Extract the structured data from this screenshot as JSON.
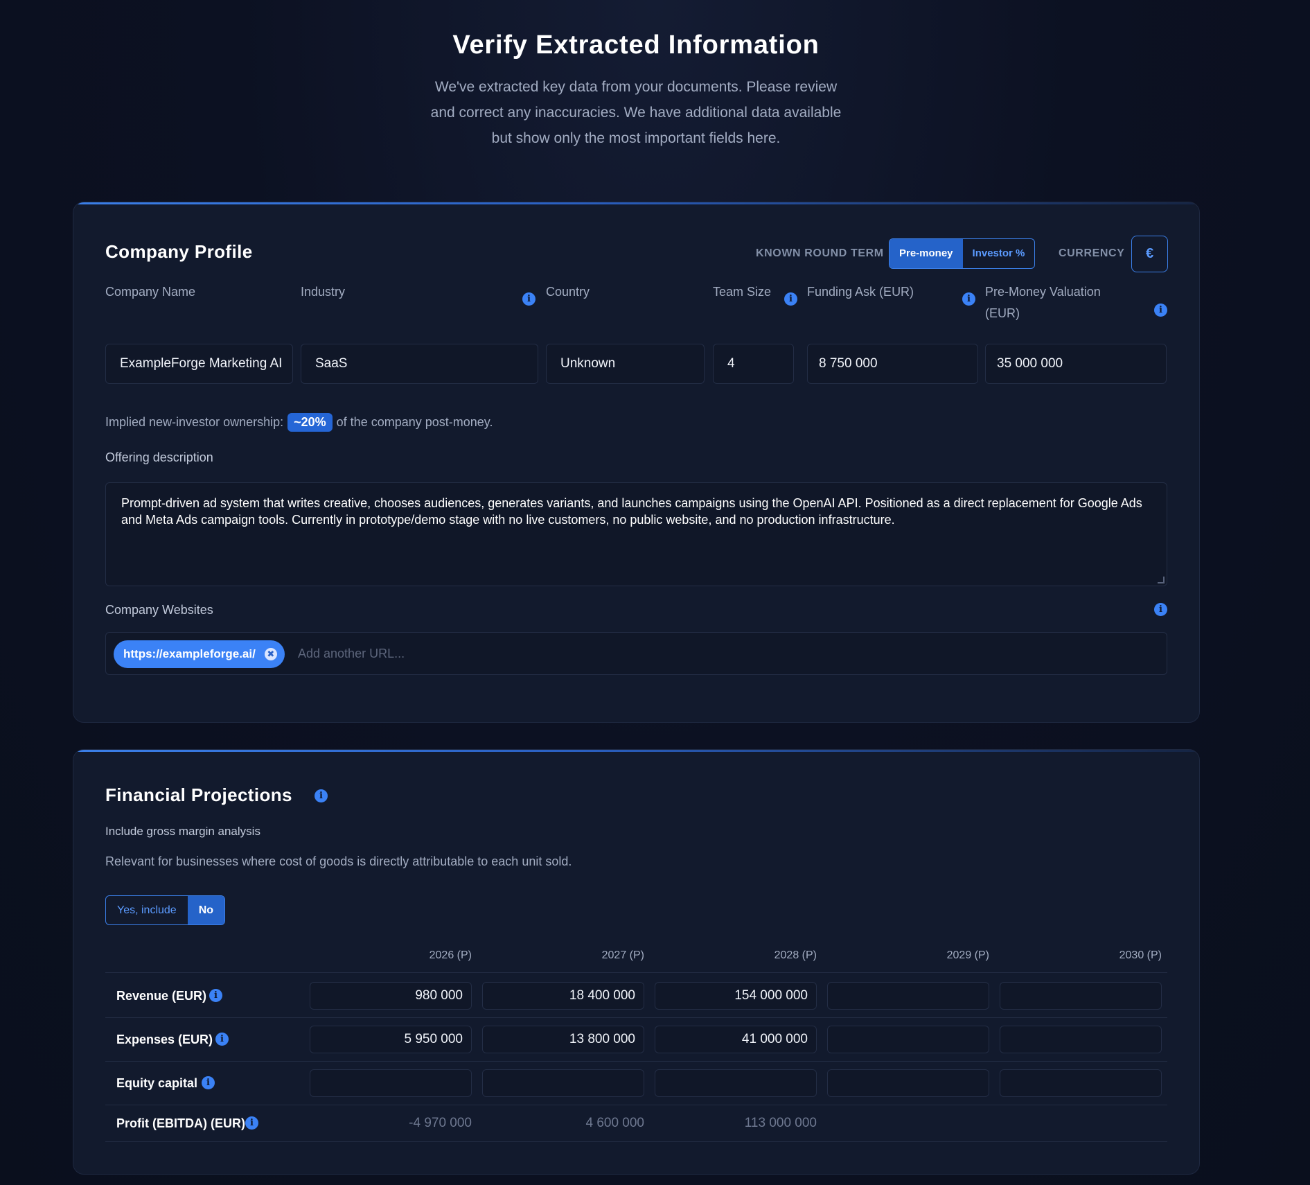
{
  "header": {
    "title": "Verify Extracted Information",
    "subtitle": "We've extracted key data from your documents. Please review and correct any inaccuracies. We have additional data available but show only the most important fields here."
  },
  "profile": {
    "title": "Company Profile",
    "round_term_label": "KNOWN ROUND TERM",
    "round_term_options": [
      "Pre-money",
      "Investor %"
    ],
    "round_term_selected": "Pre-money",
    "currency_label": "CURRENCY",
    "currency_symbol": "€",
    "fields": {
      "company_name": {
        "label": "Company Name",
        "value": "ExampleForge Marketing AI"
      },
      "industry": {
        "label": "Industry",
        "value": "SaaS"
      },
      "country": {
        "label": "Country",
        "value": "Unknown"
      },
      "team_size": {
        "label": "Team Size",
        "value": "4"
      },
      "funding_ask": {
        "label": "Funding Ask (EUR)",
        "value": "8 750 000"
      },
      "pre_money": {
        "label": "Pre-Money Valuation (EUR)",
        "value": "35 000 000"
      }
    },
    "implied_prefix": "Implied new-investor ownership:",
    "implied_value": "~20%",
    "implied_suffix": "of the company post-money.",
    "offering_label": "Offering description",
    "offering_text": "Prompt-driven ad system that writes creative, chooses audiences, generates variants, and launches campaigns using the OpenAI API. Positioned as a direct replacement for Google Ads and Meta Ads campaign tools. Currently in prototype/demo stage with no live customers, no public website, and no production infrastructure.",
    "websites_label": "Company Websites",
    "websites": [
      "https://exampleforge.ai/"
    ],
    "website_placeholder": "Add another URL..."
  },
  "financials": {
    "title": "Financial Projections",
    "gross_margin_label": "Include gross margin analysis",
    "gross_margin_desc": "Relevant for businesses where cost of goods is directly attributable to each unit sold.",
    "toggle_options": [
      "Yes, include",
      "No"
    ],
    "toggle_selected": "No",
    "years": [
      "2026 (P)",
      "2027 (P)",
      "2028 (P)",
      "2029 (P)",
      "2030 (P)"
    ],
    "rows": [
      {
        "label": "Revenue (EUR)",
        "values": [
          "980 000",
          "18 400 000",
          "154 000 000",
          "",
          ""
        ]
      },
      {
        "label": "Expenses (EUR)",
        "values": [
          "5 950 000",
          "13 800 000",
          "41 000 000",
          "",
          ""
        ]
      },
      {
        "label": "Equity capital",
        "values": [
          "",
          "",
          "",
          "",
          ""
        ]
      },
      {
        "label": "Profit (EBITDA) (EUR)",
        "values": [
          "-4 970 000",
          "4 600 000",
          "113 000 000",
          "",
          ""
        ]
      }
    ]
  },
  "colors": {
    "background": "#0c1122",
    "card": "#121a2d",
    "accent": "#3b82f6"
  }
}
